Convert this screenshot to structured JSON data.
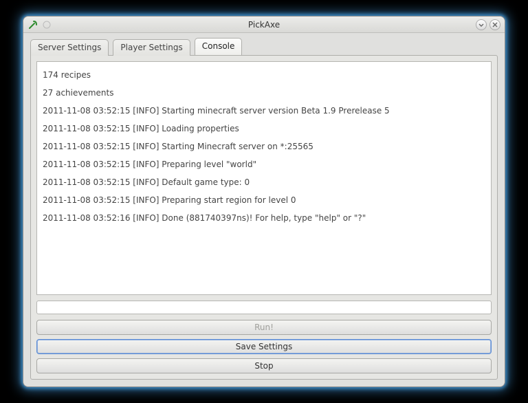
{
  "window": {
    "title": "PickAxe"
  },
  "tabs": [
    {
      "label": "Server Settings",
      "active": false
    },
    {
      "label": "Player Settings",
      "active": false
    },
    {
      "label": "Console",
      "active": true
    }
  ],
  "console": {
    "lines": [
      "174 recipes",
      "27 achievements",
      "2011-11-08 03:52:15 [INFO] Starting minecraft server version Beta 1.9 Prerelease 5",
      "2011-11-08 03:52:15 [INFO] Loading properties",
      "2011-11-08 03:52:15 [INFO] Starting Minecraft server on *:25565",
      "2011-11-08 03:52:15 [INFO] Preparing level \"world\"",
      "2011-11-08 03:52:15 [INFO] Default game type: 0",
      "2011-11-08 03:52:15 [INFO] Preparing start region for level 0",
      "2011-11-08 03:52:16 [INFO] Done (881740397ns)! For help, type \"help\" or \"?\""
    ],
    "input_value": ""
  },
  "buttons": {
    "run": "Run!",
    "save": "Save Settings",
    "stop": "Stop"
  }
}
